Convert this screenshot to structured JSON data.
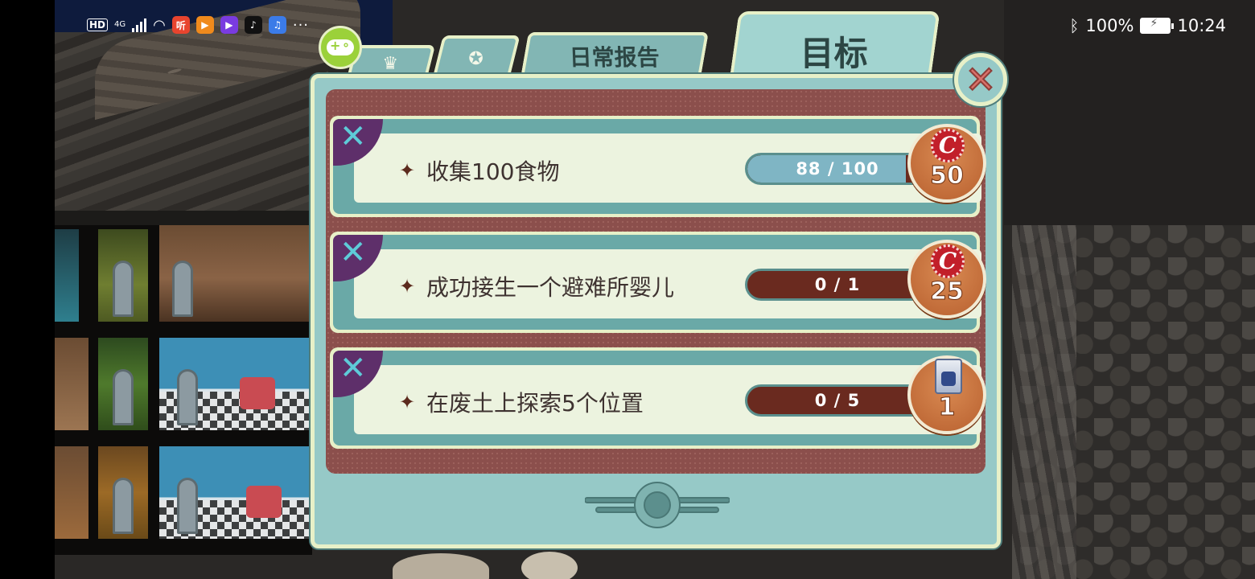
{
  "status_bar": {
    "hd": "HD",
    "network": "4G",
    "app_icons": [
      {
        "name": "listen-app-icon",
        "glyph": "听",
        "color": "#e8442e"
      },
      {
        "name": "video-app-icon",
        "glyph": "▶",
        "color": "#f08a1c"
      },
      {
        "name": "play-app-icon",
        "glyph": "▶",
        "color": "#7a3be0"
      },
      {
        "name": "tiktok-app-icon",
        "glyph": "♪",
        "color": "#111111"
      },
      {
        "name": "music-app-icon",
        "glyph": "♫",
        "color": "#3b7be8"
      }
    ],
    "more": "···",
    "bluetooth_icon": "bluetooth-icon",
    "battery": "100%",
    "time": "10:24"
  },
  "dialog": {
    "tabs": [
      {
        "id": "crown",
        "icon": "♛",
        "label": ""
      },
      {
        "id": "medal",
        "icon": "✪",
        "label": ""
      },
      {
        "id": "daily",
        "label": "日常报告"
      },
      {
        "id": "goals",
        "label": "目标",
        "active": true
      }
    ],
    "close_icon": "✕",
    "objectives": [
      {
        "text": "收集100食物",
        "progress_text": "88 / 100",
        "progress": 0.88,
        "reward_type": "caps",
        "reward": "50"
      },
      {
        "text": "成功接生一个避难所婴儿",
        "progress_text": "0 / 1",
        "progress": 0,
        "reward_type": "caps",
        "reward": "25"
      },
      {
        "text": "在废土上探索5个位置",
        "progress_text": "0 / 5",
        "progress": 0,
        "reward_type": "lunchbox",
        "reward": "1"
      }
    ]
  },
  "colors": {
    "panel": "#96c9c7",
    "panel_border": "#e7f0c8",
    "inner_bg": "#8b4f4c",
    "progress_track": "#6a2a1f",
    "progress_fill": "#7fb5c4",
    "reward_badge": "#c9723c",
    "cap_red": "#c21f2a"
  }
}
